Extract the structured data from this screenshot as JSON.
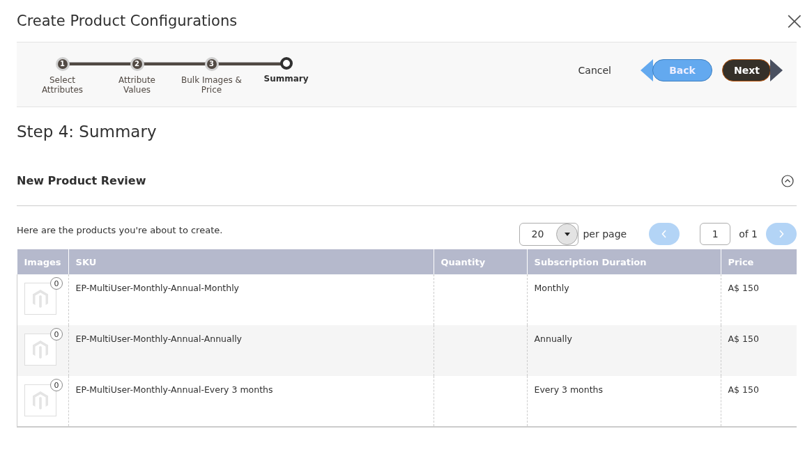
{
  "window": {
    "title": "Create Product Configurations",
    "close": "×"
  },
  "wizard": {
    "steps": [
      {
        "number": "1",
        "label": "Select Attributes",
        "selected": false
      },
      {
        "number": "2",
        "label": "Attribute Values",
        "selected": false
      },
      {
        "number": "3",
        "label": "Bulk Images & Price",
        "selected": false
      },
      {
        "label": "Summary",
        "selected": true
      }
    ],
    "buttons": [
      {
        "kind": "link",
        "label": "Cancel"
      },
      {
        "kind": "back",
        "label": "Back"
      },
      {
        "kind": "next",
        "label": "Next"
      }
    ]
  },
  "step_title": "Step 4: Summary",
  "section": {
    "title": "New Product Review",
    "expanded": true,
    "intro": "Here are the products you're about to create.",
    "pager": {
      "per_page": "20",
      "per_page_label": "per page",
      "page": "1",
      "of": "of 1",
      "prev_disabled": true,
      "next_disabled": true
    },
    "table": {
      "columns": [
        "Images",
        "SKU",
        "Quantity",
        "Subscription Duration",
        "Price"
      ],
      "rows": [
        {
          "images": "0",
          "sku": "EP-MultiUser-Monthly-Annual-Monthly",
          "duration": "Monthly",
          "price": "A$ 150"
        },
        {
          "images": "0",
          "sku": "EP-MultiUser-Monthly-Annual-Annually",
          "duration": "Annually",
          "price": "A$ 150"
        },
        {
          "images": "0",
          "sku": "EP-MultiUser-Monthly-Annual-Every 3 months",
          "duration": "Every 3 months",
          "price": "A$ 150"
        }
      ]
    }
  }
}
